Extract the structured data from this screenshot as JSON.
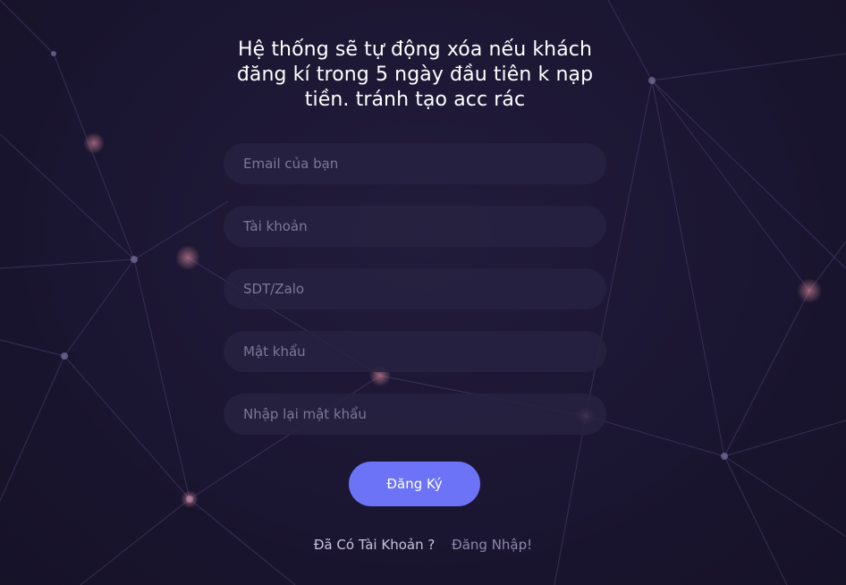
{
  "title": "Hệ thống sẽ tự động xóa nếu khách đăng kí trong 5 ngày đầu tiên k nạp tiền. tránh tạo acc rác",
  "form": {
    "email_placeholder": "Email của bạn",
    "username_placeholder": "Tài khoản",
    "phone_placeholder": "SDT/Zalo",
    "password_placeholder": "Mật khẩu",
    "confirm_placeholder": "Nhập lại mật khẩu",
    "submit_label": "Đăng Ký"
  },
  "footer": {
    "question": "Đã Có Tài Khoản ?",
    "login_link": "Đăng Nhập!"
  },
  "colors": {
    "background": "#1a1530",
    "field_bg": "#282242",
    "button": "#6c73f6"
  }
}
